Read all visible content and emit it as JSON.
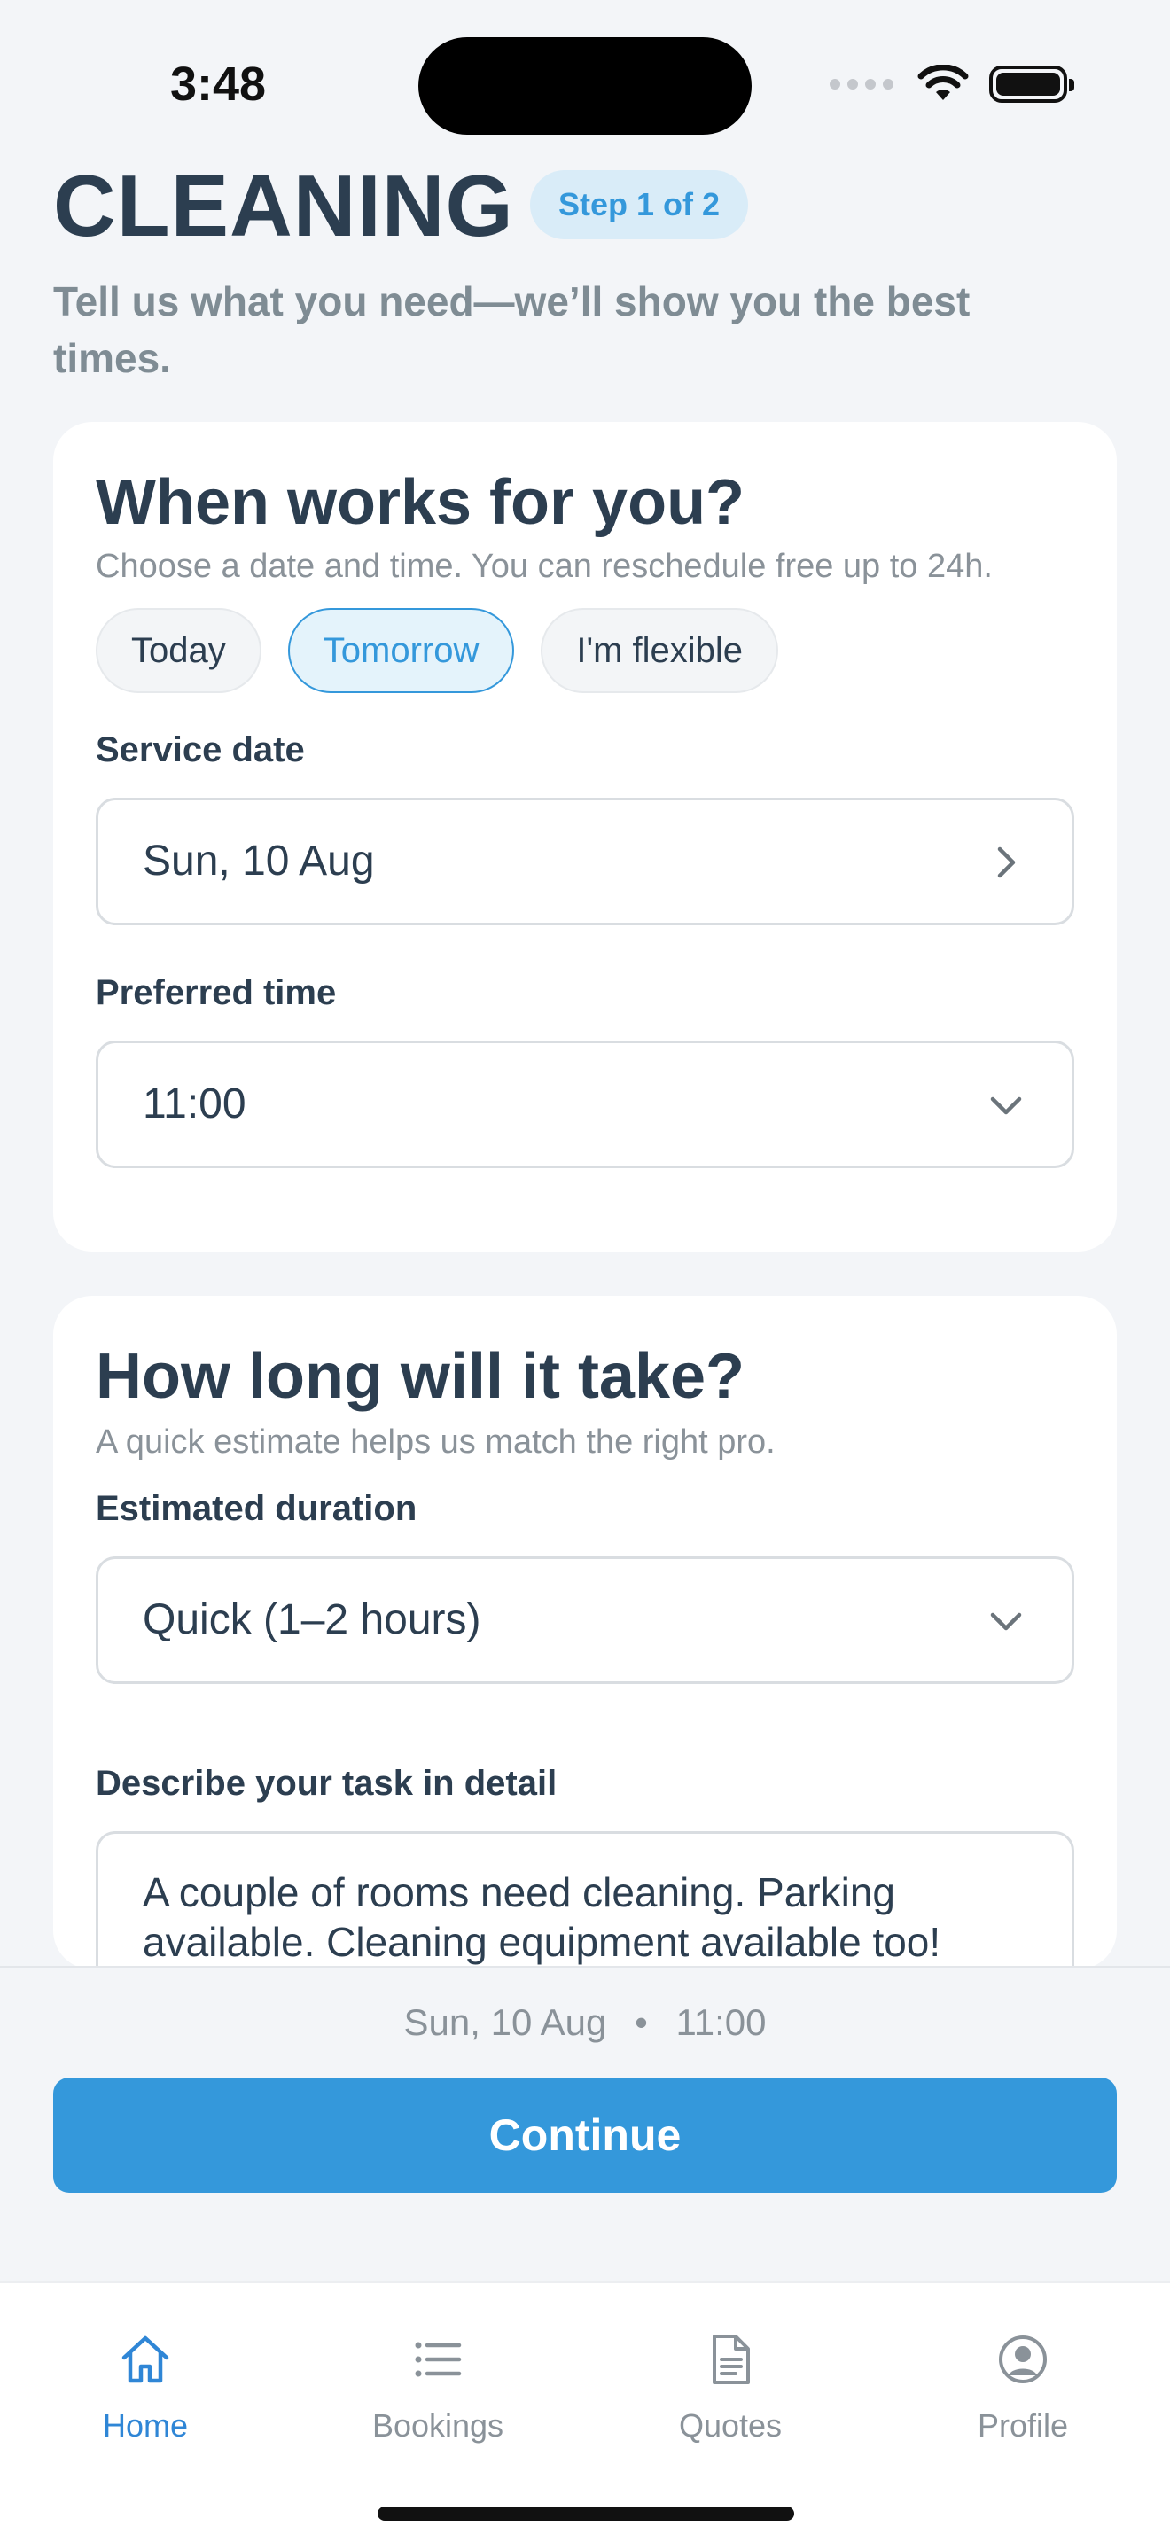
{
  "status_bar": {
    "time": "3:48"
  },
  "header": {
    "title": "CLEANING",
    "step_badge": "Step 1 of 2",
    "subtitle": "Tell us what you need—we’ll show you the best times."
  },
  "schedule_card": {
    "title": "When works for you?",
    "subtitle": "Choose a date and time. You can reschedule free up to 24h.",
    "chips": [
      {
        "label": "Today",
        "selected": false
      },
      {
        "label": "Tomorrow",
        "selected": true
      },
      {
        "label": "I'm flexible",
        "selected": false
      }
    ],
    "date_label": "Service date",
    "date_value": "Sun, 10 Aug",
    "time_label": "Preferred time",
    "time_value": "11:00"
  },
  "duration_card": {
    "title": "How long will it take?",
    "subtitle": "A quick estimate helps us match the right pro.",
    "duration_label": "Estimated duration",
    "duration_value": "Quick (1–2 hours)",
    "task_label": "Describe your task in detail",
    "task_value": "A couple of rooms need cleaning. Parking available. Cleaning equipment available too!"
  },
  "footer": {
    "summary_date": "Sun, 10 Aug",
    "summary_separator": "•",
    "summary_time": "11:00",
    "continue_label": "Continue"
  },
  "tabbar": {
    "tabs": [
      {
        "label": "Home",
        "icon": "home-icon",
        "active": true
      },
      {
        "label": "Bookings",
        "icon": "list-icon",
        "active": false
      },
      {
        "label": "Quotes",
        "icon": "document-icon",
        "active": false
      },
      {
        "label": "Profile",
        "icon": "profile-icon",
        "active": false
      }
    ]
  },
  "colors": {
    "accent": "#3498db",
    "active_tab": "#2f86d6",
    "heading": "#2c3e50",
    "muted": "#8a9299",
    "background": "#f3f5f8"
  }
}
